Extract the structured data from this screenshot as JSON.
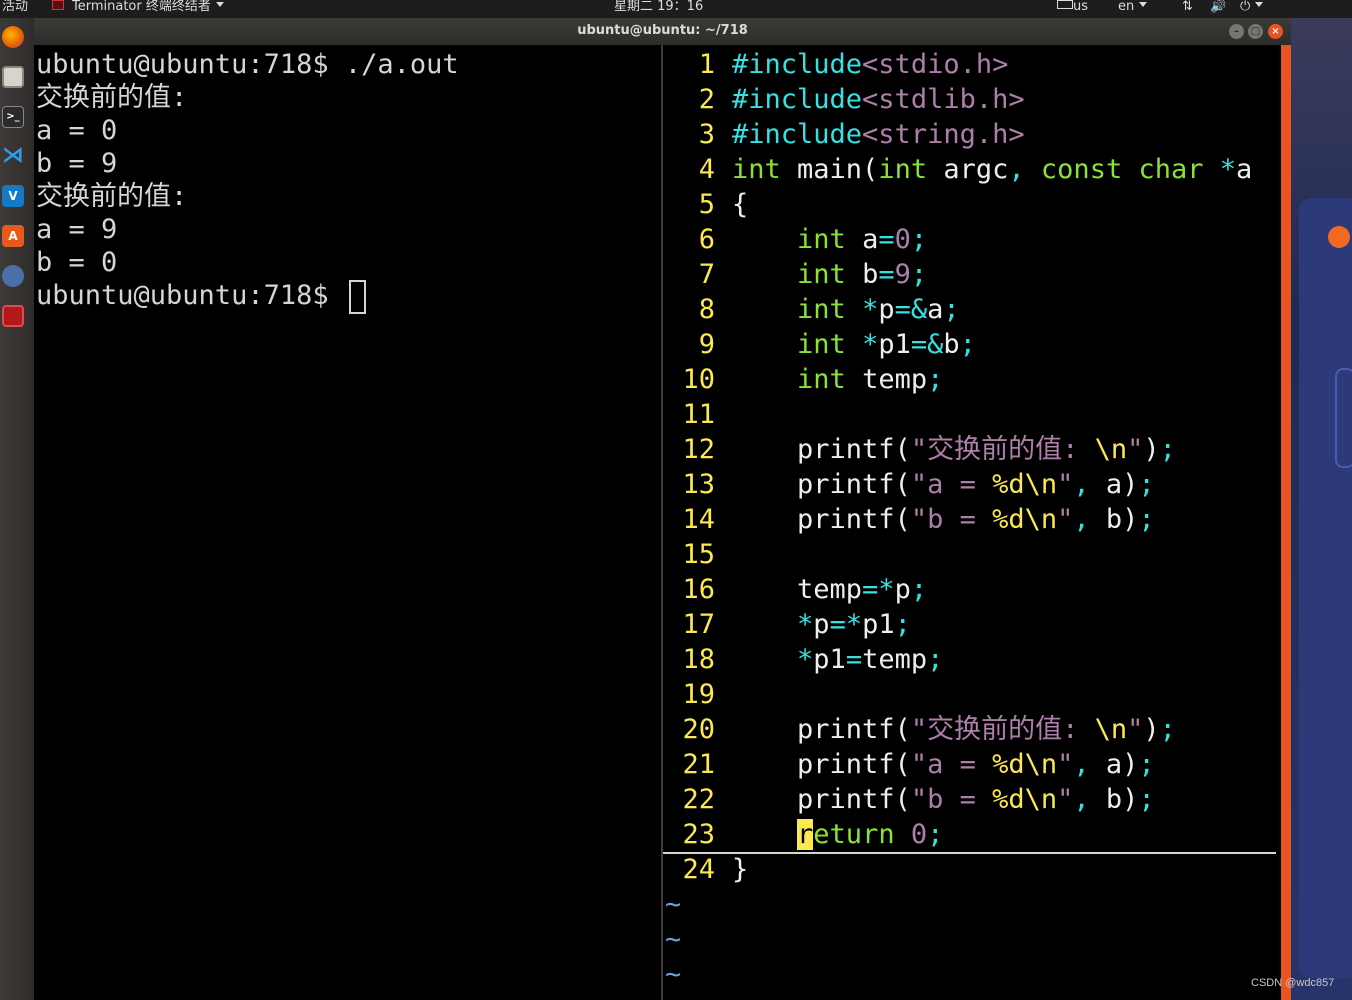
{
  "topbar": {
    "activities": "活动",
    "app_menu": "Terminator 终端终结者",
    "clock": "星期二 19：16",
    "keyboard": "us",
    "lang": "en"
  },
  "window": {
    "title": "ubuntu@ubuntu: ~/718"
  },
  "dock": {
    "icons": [
      "firefox-icon",
      "files-icon",
      "terminal-icon",
      "vscode-icon",
      "vmware-icon",
      "software-center-icon",
      "network-icon",
      "terminator-icon"
    ]
  },
  "terminal_left": {
    "lines": [
      "ubuntu@ubuntu:718$ ./a.out",
      "交换前的值:",
      "a = 0",
      "b = 9",
      "交换前的值:",
      "a = 9",
      "b = 0"
    ],
    "prompt": "ubuntu@ubuntu:718$ "
  },
  "editor": {
    "line_numbers": [
      "1",
      "2",
      "3",
      "4",
      "5",
      "6",
      "7",
      "8",
      "9",
      "10",
      "11",
      "12",
      "13",
      "14",
      "15",
      "16",
      "17",
      "18",
      "19",
      "20",
      "21",
      "22",
      "23",
      "24"
    ],
    "code": {
      "include1": "<stdio.h>",
      "include2": "<stdlib.h>",
      "include3": "<string.h>",
      "include_kw": "#include",
      "swap_str": "交换前的值: ",
      "a_fmt": "a = ",
      "b_fmt": "b = ",
      "fmt_d": "%d",
      "esc_n": "\\n"
    },
    "tildes": [
      "~",
      "~",
      "~"
    ]
  },
  "watermark": "CSDN @wdc857"
}
